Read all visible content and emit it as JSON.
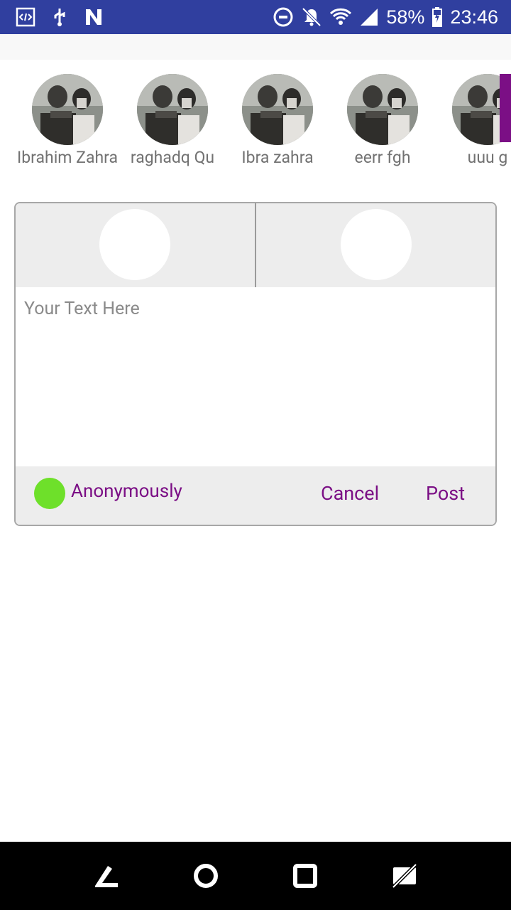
{
  "status_bar": {
    "battery": "58%",
    "time": "23:46",
    "icons": [
      "code-icon",
      "usb-icon",
      "n-icon",
      "do-not-disturb-icon",
      "notifications-off-icon",
      "wifi-icon",
      "signal-icon",
      "battery-charging-icon"
    ]
  },
  "contacts": [
    {
      "name": "Ibrahim Zahra"
    },
    {
      "name": "raghadq Qu"
    },
    {
      "name": "Ibra zahra"
    },
    {
      "name": "eerr fgh"
    },
    {
      "name": "uuu g"
    }
  ],
  "composer": {
    "placeholder": "Your Text Here",
    "anonymous_label": "Anonymously",
    "cancel_label": "Cancel",
    "post_label": "Post"
  },
  "colors": {
    "status_bar": "#303f9f",
    "accent": "#7b0f85",
    "anon_dot": "#6ee02a"
  },
  "nav_bar": {
    "icons": [
      "back-icon",
      "home-icon",
      "recents-icon",
      "rotate-icon"
    ]
  }
}
